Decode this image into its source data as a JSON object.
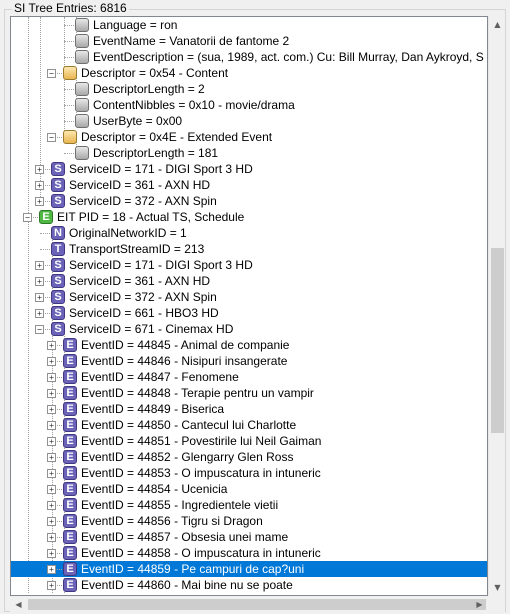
{
  "window": {
    "group_title": "SI Tree Entries: 6816"
  },
  "icons": {
    "leaf": "property-leaf-icon",
    "descriptor": "descriptor-folder-icon",
    "S": "service-icon",
    "E": "event-icon",
    "N": "network-icon",
    "T": "transport-stream-icon",
    "G": "eit-table-icon"
  },
  "colors": {
    "selection": "#0078d7",
    "service_icon": "#6b63b8",
    "eit_icon": "#4fb845",
    "descriptor_icon": "#e8b650"
  },
  "tree": {
    "rows": [
      {
        "label": "Language = ron",
        "icon": "leaf"
      },
      {
        "label": "EventName = Vanatorii de fantome 2",
        "icon": "leaf"
      },
      {
        "label": "EventDescription = (sua, 1989, act. com.) Cu: Bill Murray, Dan Aykroyd, S",
        "icon": "leaf"
      },
      {
        "label": "Descriptor = 0x54 - Content",
        "icon": "descriptor",
        "toggle": "−"
      },
      {
        "label": "DescriptorLength = 2",
        "icon": "leaf"
      },
      {
        "label": "ContentNibbles = 0x10 - movie/drama",
        "icon": "leaf"
      },
      {
        "label": "UserByte = 0x00",
        "icon": "leaf"
      },
      {
        "label": "Descriptor = 0x4E - Extended Event",
        "icon": "descriptor",
        "toggle": "−"
      },
      {
        "label": "DescriptorLength = 181",
        "icon": "leaf"
      },
      {
        "label": "ServiceID = 171 - DIGI Sport 3 HD",
        "icon": "S",
        "icon_letter": "S",
        "toggle": "+"
      },
      {
        "label": "ServiceID = 361 - AXN HD",
        "icon": "S",
        "icon_letter": "S",
        "toggle": "+"
      },
      {
        "label": "ServiceID = 372 - AXN Spin",
        "icon": "S",
        "icon_letter": "S",
        "toggle": "+"
      },
      {
        "label": "EIT PID = 18 - Actual TS, Schedule",
        "icon": "G",
        "icon_letter": "E",
        "toggle": "−"
      },
      {
        "label": "OriginalNetworkID = 1",
        "icon": "N",
        "icon_letter": "N"
      },
      {
        "label": "TransportStreamID = 213",
        "icon": "T",
        "icon_letter": "T"
      },
      {
        "label": "ServiceID = 171 - DIGI Sport 3 HD",
        "icon": "S",
        "icon_letter": "S",
        "toggle": "+"
      },
      {
        "label": "ServiceID = 361 - AXN HD",
        "icon": "S",
        "icon_letter": "S",
        "toggle": "+"
      },
      {
        "label": "ServiceID = 372 - AXN Spin",
        "icon": "S",
        "icon_letter": "S",
        "toggle": "+"
      },
      {
        "label": "ServiceID = 661 - HBO3 HD",
        "icon": "S",
        "icon_letter": "S",
        "toggle": "+"
      },
      {
        "label": "ServiceID = 671 - Cinemax HD",
        "icon": "S",
        "icon_letter": "S",
        "toggle": "−"
      },
      {
        "label": "EventID = 44845 - Animal de companie",
        "icon": "E",
        "icon_letter": "E",
        "toggle": "+"
      },
      {
        "label": "EventID = 44846 - Nisipuri insangerate",
        "icon": "E",
        "icon_letter": "E",
        "toggle": "+"
      },
      {
        "label": "EventID = 44847 - Fenomene",
        "icon": "E",
        "icon_letter": "E",
        "toggle": "+"
      },
      {
        "label": "EventID = 44848 - Terapie pentru un vampir",
        "icon": "E",
        "icon_letter": "E",
        "toggle": "+"
      },
      {
        "label": "EventID = 44849 - Biserica",
        "icon": "E",
        "icon_letter": "E",
        "toggle": "+"
      },
      {
        "label": "EventID = 44850 - Cantecul lui Charlotte",
        "icon": "E",
        "icon_letter": "E",
        "toggle": "+"
      },
      {
        "label": "EventID = 44851 - Povestirile lui Neil Gaiman",
        "icon": "E",
        "icon_letter": "E",
        "toggle": "+"
      },
      {
        "label": "EventID = 44852 - Glengarry Glen Ross",
        "icon": "E",
        "icon_letter": "E",
        "toggle": "+"
      },
      {
        "label": "EventID = 44853 - O impuscatura in intuneric",
        "icon": "E",
        "icon_letter": "E",
        "toggle": "+"
      },
      {
        "label": "EventID = 44854 - Ucenicia",
        "icon": "E",
        "icon_letter": "E",
        "toggle": "+"
      },
      {
        "label": "EventID = 44855 - Ingredientele vietii",
        "icon": "E",
        "icon_letter": "E",
        "toggle": "+"
      },
      {
        "label": "EventID = 44856 - Tigru si Dragon",
        "icon": "E",
        "icon_letter": "E",
        "toggle": "+"
      },
      {
        "label": "EventID = 44857 - Obsesia unei mame",
        "icon": "E",
        "icon_letter": "E",
        "toggle": "+"
      },
      {
        "label": "EventID = 44858 - O impuscatura in intuneric",
        "icon": "E",
        "icon_letter": "E",
        "toggle": "+"
      },
      {
        "label": "EventID = 44859 - Pe campuri de cap?uni",
        "icon": "E",
        "icon_letter": "E",
        "toggle": "+",
        "selected": true
      },
      {
        "label": "EventID = 44860 - Mai bine nu se poate",
        "icon": "E",
        "icon_letter": "E",
        "toggle": "+"
      }
    ]
  },
  "scrollbars": {
    "vertical_up_arrow": "▲",
    "vertical_down_arrow": "▼",
    "horizontal_left_arrow": "◀",
    "horizontal_right_arrow": "▶"
  }
}
